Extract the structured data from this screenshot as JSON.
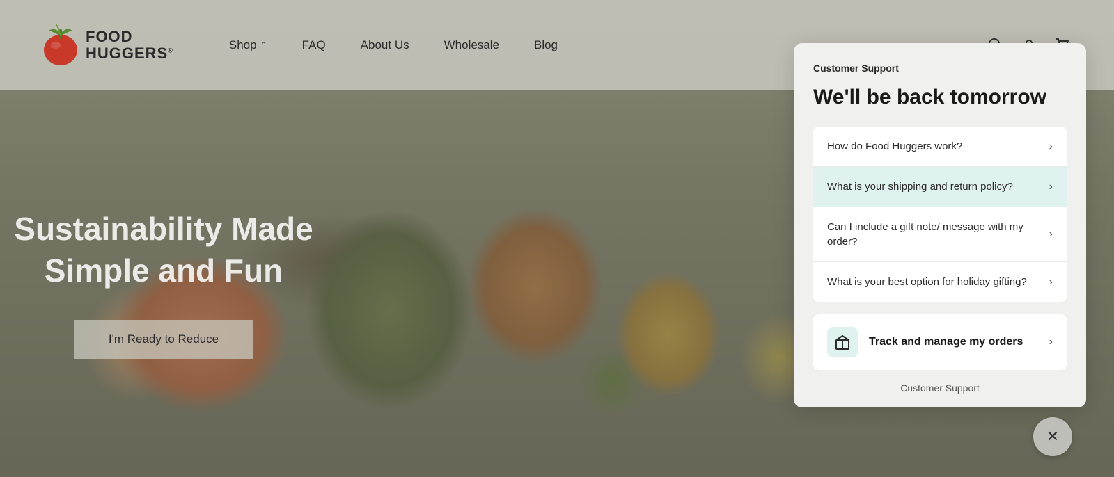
{
  "site": {
    "logo": {
      "food": "FOOD",
      "huggers": "HUGGERS"
    }
  },
  "nav": {
    "items": [
      {
        "label": "Shop",
        "has_dropdown": true
      },
      {
        "label": "FAQ",
        "has_dropdown": false
      },
      {
        "label": "About Us",
        "has_dropdown": false
      },
      {
        "label": "Wholesale",
        "has_dropdown": false
      },
      {
        "label": "Blog",
        "has_dropdown": false
      }
    ]
  },
  "hero": {
    "title": "Sustainability Made Simple and Fun",
    "cta_label": "I'm Ready to Reduce"
  },
  "support_panel": {
    "header": "Customer Support",
    "headline": "We'll be back tomorrow",
    "faq_items": [
      {
        "text": "How do Food Huggers work?",
        "highlighted": false
      },
      {
        "text": "What is your shipping and return policy?",
        "highlighted": true
      },
      {
        "text": "Can I include a gift note/ message with my order?",
        "highlighted": false
      },
      {
        "text": "What is your best option for holiday gifting?",
        "highlighted": false
      }
    ],
    "track_orders": {
      "label": "Track and manage my orders"
    },
    "bottom_peek": "Customer Support"
  },
  "close_button": {
    "symbol": "✕"
  }
}
